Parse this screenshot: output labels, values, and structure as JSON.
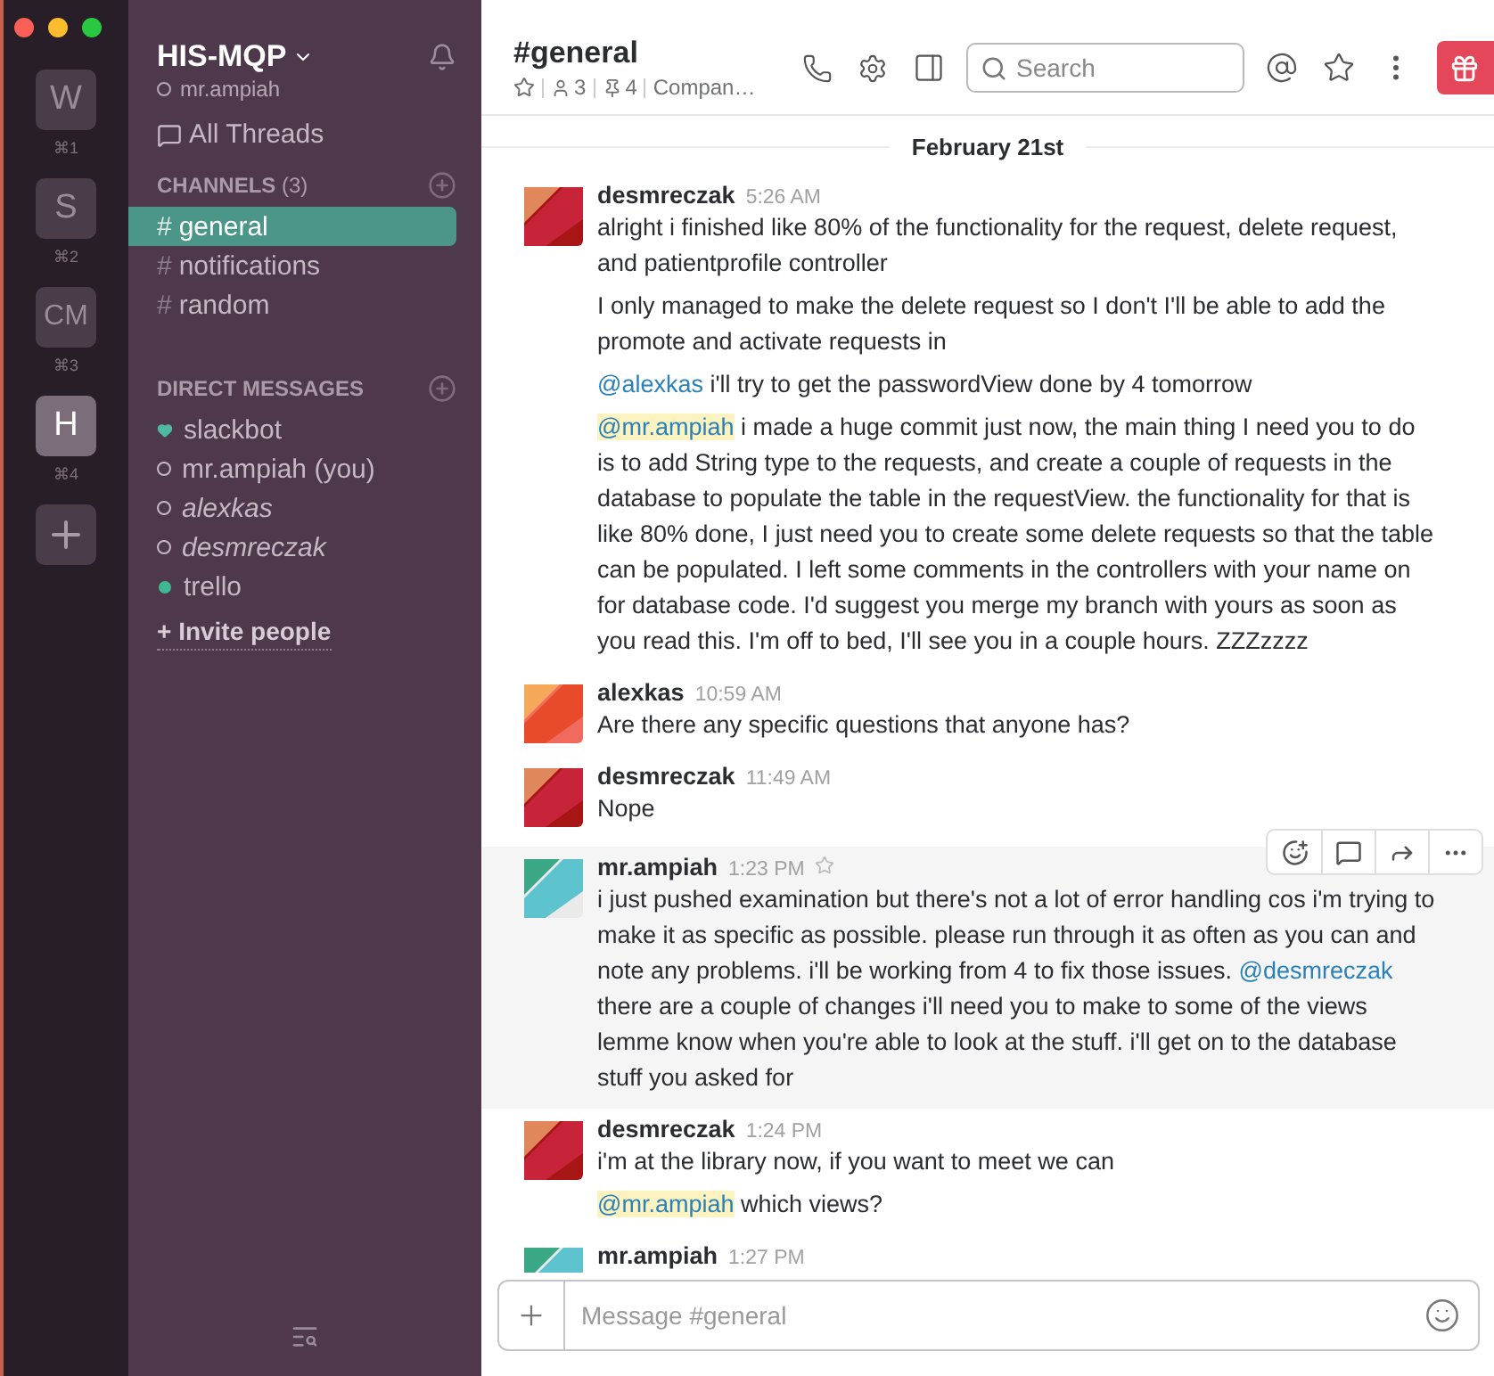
{
  "teams": [
    {
      "letter": "W",
      "shortcut": "⌘1",
      "selected": false
    },
    {
      "letter": "S",
      "shortcut": "⌘2",
      "selected": false
    },
    {
      "letter": "CM",
      "shortcut": "⌘3",
      "selected": false
    },
    {
      "letter": "H",
      "shortcut": "⌘4",
      "selected": true
    }
  ],
  "sidebar": {
    "team_name": "HIS-MQP",
    "user": "mr.ampiah",
    "all_threads": "All Threads",
    "channels_header": "CHANNELS",
    "channels_count": "(3)",
    "channels": [
      {
        "symbol": "#",
        "name": "general",
        "selected": true
      },
      {
        "symbol": "#",
        "name": "notifications",
        "selected": false
      },
      {
        "symbol": "#",
        "name": "random",
        "selected": false
      }
    ],
    "dm_header": "DIRECT MESSAGES",
    "direct_messages": [
      {
        "name": "slackbot",
        "kind": "bot",
        "italic": false
      },
      {
        "name": "mr.ampiah (you)",
        "kind": "away",
        "italic": false
      },
      {
        "name": "alexkas",
        "kind": "away",
        "italic": true
      },
      {
        "name": "desmreczak",
        "kind": "away",
        "italic": true
      },
      {
        "name": "trello",
        "kind": "active",
        "italic": false
      }
    ],
    "invite": "+ Invite people"
  },
  "channel_header": {
    "title": "#general",
    "members": "3",
    "pins": "4",
    "topic": "Compan…",
    "search_placeholder": "Search"
  },
  "date_divider": "February 21st",
  "messages": [
    {
      "author": "desmreczak",
      "time": "5:26 AM",
      "kind": "red",
      "hovered": false,
      "paragraphs": [
        [
          {
            "kind": "text",
            "text": "alright i finished like 80% of the functionality for the request, delete request, and patientprofile controller"
          }
        ],
        [
          {
            "kind": "text",
            "text": "I only managed to make the delete request so I don't I'll be able to add the promote and activate requests in"
          }
        ],
        [
          {
            "kind": "mention",
            "text": "@alexkas",
            "self": false
          },
          {
            "kind": "text",
            "text": " i'll try to get the passwordView done by 4 tomorrow"
          }
        ],
        [
          {
            "kind": "mention",
            "text": "@mr.ampiah",
            "self": true
          },
          {
            "kind": "text",
            "text": " i made a huge commit just now, the main thing I need you to do is to add String type to the requests, and create a couple of requests in the database to populate the table in the requestView. the functionality for that is like 80% done, I just need you to create some delete requests so that the table can be populated. I left some comments in the controllers with your name on for database code.  I'd suggest you merge my branch with yours as soon as you read this. I'm off to bed, I'll see you in a couple hours. ZZZzzzz"
          }
        ]
      ]
    },
    {
      "author": "alexkas",
      "time": "10:59 AM",
      "kind": "orange",
      "hovered": false,
      "paragraphs": [
        [
          {
            "kind": "text",
            "text": "Are there any specific questions that anyone has?"
          }
        ]
      ]
    },
    {
      "author": "desmreczak",
      "time": "11:49 AM",
      "kind": "red",
      "hovered": false,
      "paragraphs": [
        [
          {
            "kind": "text",
            "text": "Nope"
          }
        ]
      ]
    },
    {
      "author": "mr.ampiah",
      "time": "1:23 PM",
      "kind": "green",
      "hovered": true,
      "paragraphs": [
        [
          {
            "kind": "text",
            "text": "i just pushed examination but there's not a lot of error handling cos i'm trying to make it as specific as possible. please run through it as often as you can and note any problems. i'll be working from 4 to fix those issues. "
          },
          {
            "kind": "mention",
            "text": "@desmreczak",
            "self": false
          },
          {
            "kind": "text",
            "text": " there are a couple of changes i'll need you to make to some of the views lemme know when you're able to look at the stuff. i'll get on to the database stuff you asked for"
          }
        ]
      ]
    },
    {
      "author": "desmreczak",
      "time": "1:24 PM",
      "kind": "red",
      "hovered": false,
      "paragraphs": [
        [
          {
            "kind": "text",
            "text": "i'm at the library now, if you want to meet we can"
          }
        ],
        [
          {
            "kind": "mention",
            "text": "@mr.ampiah",
            "self": true
          },
          {
            "kind": "text",
            "text": " which views?"
          }
        ]
      ]
    },
    {
      "author": "mr.ampiah",
      "time": "1:27 PM",
      "kind": "green",
      "hovered": false
    }
  ],
  "composer": {
    "placeholder": "Message #general"
  }
}
